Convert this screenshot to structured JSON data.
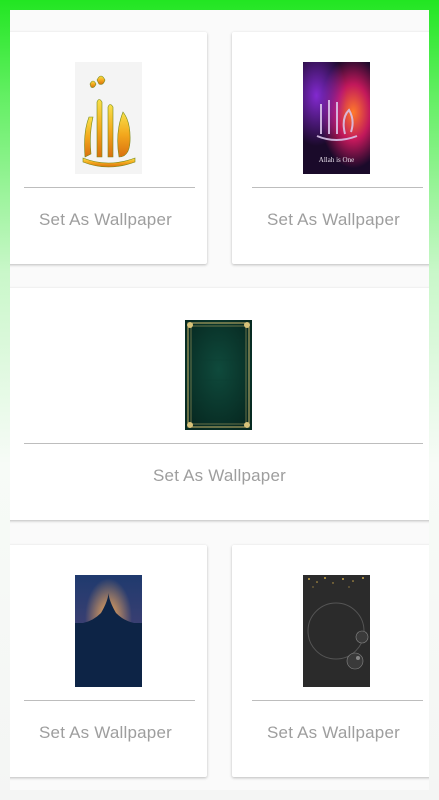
{
  "wallpapers": [
    {
      "button_label": "Set As Wallpaper",
      "image": "allah-calligraphy-gold"
    },
    {
      "button_label": "Set As Wallpaper",
      "image": "allah-neon-glow",
      "caption": "Allah is One"
    },
    {
      "button_label": "Set As Wallpaper",
      "image": "green-ornamental-frame"
    },
    {
      "button_label": "Set As Wallpaper",
      "image": "mosque-dome-silhouette"
    },
    {
      "button_label": "Set As Wallpaper",
      "image": "black-gold-bubbles"
    }
  ],
  "colors": {
    "top_gradient": "#22e622",
    "card_bg": "#ffffff",
    "button_text": "#9e9e9e",
    "divider": "#bdbdbd"
  }
}
